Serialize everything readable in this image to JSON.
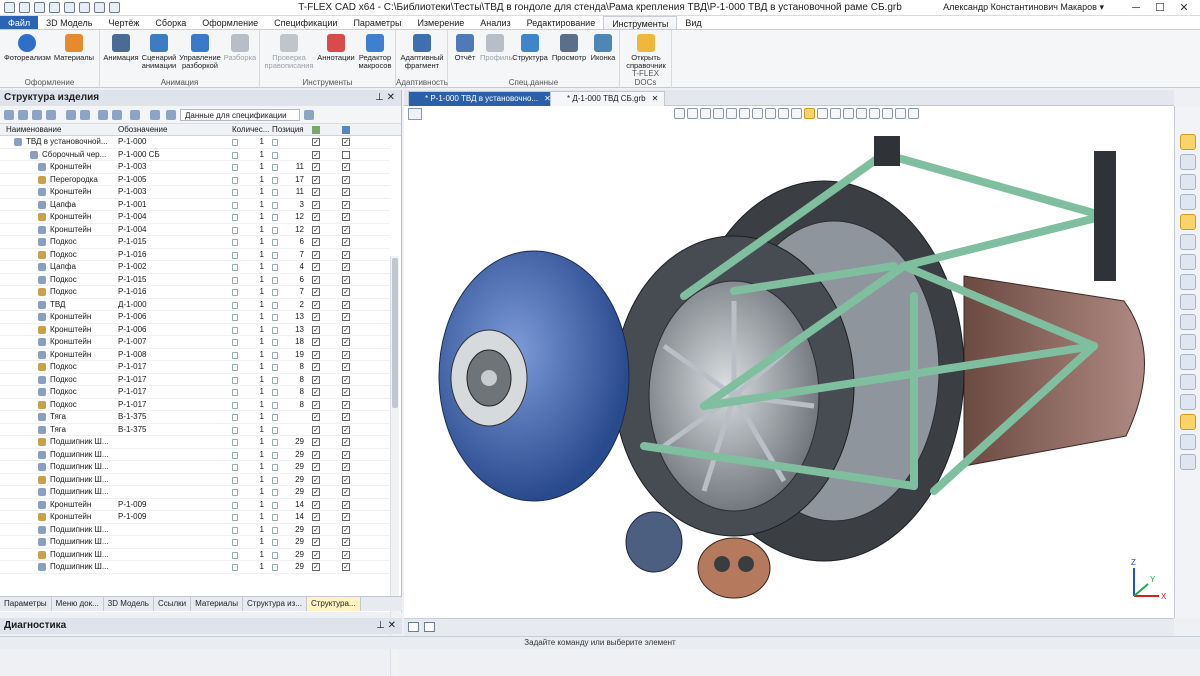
{
  "app": {
    "title": "T-FLEX CAD x64 - C:\\Библиотеки\\Тесты\\ТВД в гондоле для стенда\\Рама крепления ТВД\\Р-1-000 ТВД в установочной раме СБ.grb",
    "user": "Александр Константинович Макаров ▾",
    "min": "─",
    "max": "☐",
    "close": "✕"
  },
  "menu": [
    "Файл",
    "3D Модель",
    "Чертёж",
    "Сборка",
    "Оформление",
    "Спецификации",
    "Параметры",
    "Измерение",
    "Анализ",
    "Редактирование",
    "Инструменты",
    "Вид"
  ],
  "ribbon": {
    "groups": [
      {
        "name": "Оформление",
        "buttons": [
          {
            "label": "Фотореализм",
            "icon": "sphere-icon",
            "color": "#2f6fc9"
          },
          {
            "label": "Материалы",
            "icon": "paint-icon",
            "color": "#e68a2e"
          }
        ]
      },
      {
        "name": "Анимация",
        "buttons": [
          {
            "label": "Анимация",
            "icon": "film-icon",
            "color": "#4a6b93"
          },
          {
            "label": "Сценарий анимации",
            "icon": "script-icon",
            "color": "#3d7cc0"
          },
          {
            "label": "Управление разборкой",
            "icon": "explode-icon",
            "color": "#3a7acb"
          },
          {
            "label": "Разборка",
            "icon": "cubes-icon",
            "color": "#b8bec6",
            "disabled": true
          }
        ]
      },
      {
        "name": "Инструменты",
        "buttons": [
          {
            "label": "Проверка правописания",
            "icon": "check-doc-icon",
            "color": "#c0c5cc",
            "disabled": true
          },
          {
            "label": "Аннотации",
            "icon": "pencils-icon",
            "color": "#d94b4b"
          },
          {
            "label": "Редактор макросов",
            "icon": "macro-icon",
            "color": "#3f7fcf"
          }
        ]
      },
      {
        "name": "Адаптивность",
        "buttons": [
          {
            "label": "Адаптивный фрагмент",
            "icon": "adaptive-icon",
            "color": "#3f6fb0"
          }
        ]
      },
      {
        "name": "Спец.данные",
        "buttons": [
          {
            "label": "Отчёт",
            "icon": "report-icon",
            "color": "#4f79b7"
          },
          {
            "label": "Профиль",
            "icon": "profile-icon",
            "color": "#b8bec6",
            "disabled": true
          },
          {
            "label": "Структура",
            "icon": "structure-icon",
            "color": "#3e86c9"
          },
          {
            "label": "Просмотр",
            "icon": "camera-icon",
            "color": "#5a6f8a"
          },
          {
            "label": "Иконка",
            "icon": "picture-icon",
            "color": "#4e86b8"
          }
        ]
      },
      {
        "name": "T-FLEX DOCs",
        "buttons": [
          {
            "label": "Открыть справочник",
            "icon": "folder-icon",
            "color": "#f0b73a"
          }
        ]
      }
    ]
  },
  "panel": {
    "title": "Структура изделия",
    "pin": "⊥ ✕",
    "dropdown": "Данные для спецификации",
    "headers": [
      "Наименование",
      "Обозначение",
      "Количес...",
      "Позиция"
    ]
  },
  "rows": [
    [
      "ТВД в установочной...",
      "Р-1-000",
      "1",
      "",
      true,
      true
    ],
    [
      "Сборочный чер...",
      "Р-1-000 СБ",
      "1",
      "",
      true,
      false
    ],
    [
      "Кронштейн",
      "Р-1-003",
      "1",
      "11",
      true,
      true
    ],
    [
      "Перегородка",
      "Р-1-005",
      "1",
      "17",
      true,
      true
    ],
    [
      "Кронштейн",
      "Р-1-003",
      "1",
      "11",
      true,
      true
    ],
    [
      "Цапфа",
      "Р-1-001",
      "1",
      "3",
      true,
      true
    ],
    [
      "Кронштейн",
      "Р-1-004",
      "1",
      "12",
      true,
      true
    ],
    [
      "Кронштейн",
      "Р-1-004",
      "1",
      "12",
      true,
      true
    ],
    [
      "Подкос",
      "Р-1-015",
      "1",
      "6",
      true,
      true
    ],
    [
      "Подкос",
      "Р-1-016",
      "1",
      "7",
      true,
      true
    ],
    [
      "Цапфа",
      "Р-1-002",
      "1",
      "4",
      true,
      true
    ],
    [
      "Подкос",
      "Р-1-015",
      "1",
      "6",
      true,
      true
    ],
    [
      "Подкос",
      "Р-1-016",
      "1",
      "7",
      true,
      true
    ],
    [
      "ТВД",
      "Д-1-000",
      "1",
      "2",
      true,
      true
    ],
    [
      "Кронштейн",
      "Р-1-006",
      "1",
      "13",
      true,
      true
    ],
    [
      "Кронштейн",
      "Р-1-006",
      "1",
      "13",
      true,
      true
    ],
    [
      "Кронштейн",
      "Р-1-007",
      "1",
      "18",
      true,
      true
    ],
    [
      "Кронштейн",
      "Р-1-008",
      "1",
      "19",
      true,
      true
    ],
    [
      "Подкос",
      "Р-1-017",
      "1",
      "8",
      true,
      true
    ],
    [
      "Подкос",
      "Р-1-017",
      "1",
      "8",
      true,
      true
    ],
    [
      "Подкос",
      "Р-1-017",
      "1",
      "8",
      true,
      true
    ],
    [
      "Подкос",
      "Р-1-017",
      "1",
      "8",
      true,
      true
    ],
    [
      "Тяга",
      "В-1-375",
      "1",
      "",
      true,
      true
    ],
    [
      "Тяга",
      "В-1-375",
      "1",
      "",
      true,
      true
    ],
    [
      "Подшипник Ш...",
      "",
      "1",
      "29",
      true,
      true
    ],
    [
      "Подшипник Ш...",
      "",
      "1",
      "29",
      true,
      true
    ],
    [
      "Подшипник Ш...",
      "",
      "1",
      "29",
      true,
      true
    ],
    [
      "Подшипник Ш...",
      "",
      "1",
      "29",
      true,
      true
    ],
    [
      "Подшипник Ш...",
      "",
      "1",
      "29",
      true,
      true
    ],
    [
      "Кронштейн",
      "Р-1-009",
      "1",
      "14",
      true,
      true
    ],
    [
      "Кронштейн",
      "Р-1-009",
      "1",
      "14",
      true,
      true
    ],
    [
      "Подшипник Ш...",
      "",
      "1",
      "29",
      true,
      true
    ],
    [
      "Подшипник Ш...",
      "",
      "1",
      "29",
      true,
      true
    ],
    [
      "Подшипник Ш...",
      "",
      "1",
      "29",
      true,
      true
    ],
    [
      "Подшипник Ш...",
      "",
      "1",
      "29",
      true,
      true
    ]
  ],
  "bottom_tabs": [
    "Параметры",
    "Меню док...",
    "3D Модель",
    "Ссылки",
    "Материалы",
    "Структура из...",
    "Структура..."
  ],
  "diagnostics": {
    "title": "Диагностика",
    "pin": "⊥ ✕"
  },
  "doc_tabs": [
    {
      "label": "* Р-1-000 ТВД в установочно...",
      "close": "✕"
    },
    {
      "label": "* Д-1-000 ТВД СБ.grb",
      "close": "✕"
    }
  ],
  "status": "Задайте команду или выберите элемент",
  "axes": {
    "x": "X",
    "y": "Y",
    "z": "Z"
  }
}
